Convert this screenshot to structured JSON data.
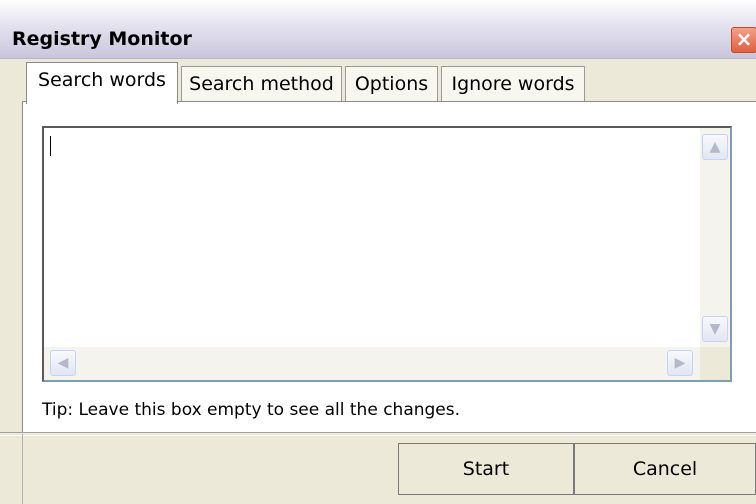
{
  "window": {
    "title": "Registry Monitor",
    "close_label": "×"
  },
  "tabs": [
    {
      "label": "Search words",
      "active": true
    },
    {
      "label": "Search method",
      "active": false
    },
    {
      "label": "Options",
      "active": false
    },
    {
      "label": "Ignore words",
      "active": false
    }
  ],
  "search_words": {
    "value": "",
    "tip": "Tip: Leave this box empty to see all the changes."
  },
  "scrollbar": {
    "up": "▲",
    "down": "▼",
    "left": "◀",
    "right": "▶"
  },
  "buttons": {
    "start_label": "Start",
    "cancel_label": "Cancel"
  },
  "colors": {
    "dialog_background": "#ece9d8",
    "close_button": "#e0603f",
    "textbox_border": "#7f9db9"
  }
}
